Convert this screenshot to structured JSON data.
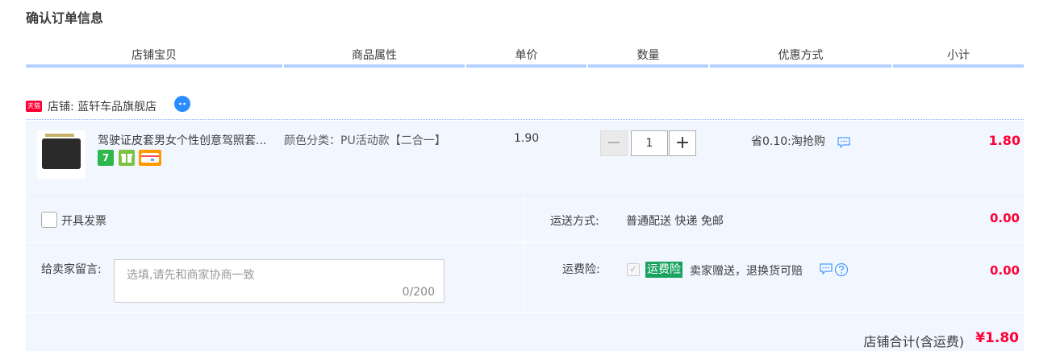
{
  "page": {
    "title": "确认订单信息"
  },
  "columns": [
    "店铺宝贝",
    "商品属性",
    "单价",
    "数量",
    "优惠方式",
    "小计"
  ],
  "shop": {
    "tmall_badge": "天猫",
    "label": "店铺: 蓝轩车品旗舰店",
    "wangwang_icon": "wangwang-chat-icon"
  },
  "item": {
    "title": "驾驶证皮套男女个性创意驾照套...",
    "badges": [
      {
        "text": "7",
        "color": "#2db84d",
        "icon": "7-day-return-icon"
      },
      {
        "text": "",
        "color": "#7dc242",
        "icon": "gift-icon"
      },
      {
        "text": "",
        "color": "#ff9900",
        "icon": "credit-card-icon"
      }
    ],
    "attribute": "颜色分类：PU活动款【二合一】",
    "unit_price": "1.90",
    "qty_minus": "−",
    "quantity": "1",
    "qty_plus": "+",
    "promotion": "省0.10:淘抢购",
    "subtotal": "1.80"
  },
  "invoice": {
    "label": "开具发票"
  },
  "shipping": {
    "label": "运送方式:",
    "value": "普通配送 快递 免邮",
    "amount": "0.00"
  },
  "message": {
    "label": "给卖家留言:",
    "placeholder": "选填,请先和商家协商一致",
    "count": "0/200"
  },
  "insurance": {
    "label": "运费险:",
    "checkbox": "✓",
    "tag": "运费险",
    "text": "卖家赠送，退换货可赔",
    "amount": "0.00"
  },
  "total": {
    "label": "店铺合计(含运费)",
    "value": "¥1.80"
  },
  "colors": {
    "accent_red": "#ff0036",
    "row_bg": "#f2f7ff",
    "header_line": "#b2d1ff",
    "insurance_green": "#1aa260"
  }
}
